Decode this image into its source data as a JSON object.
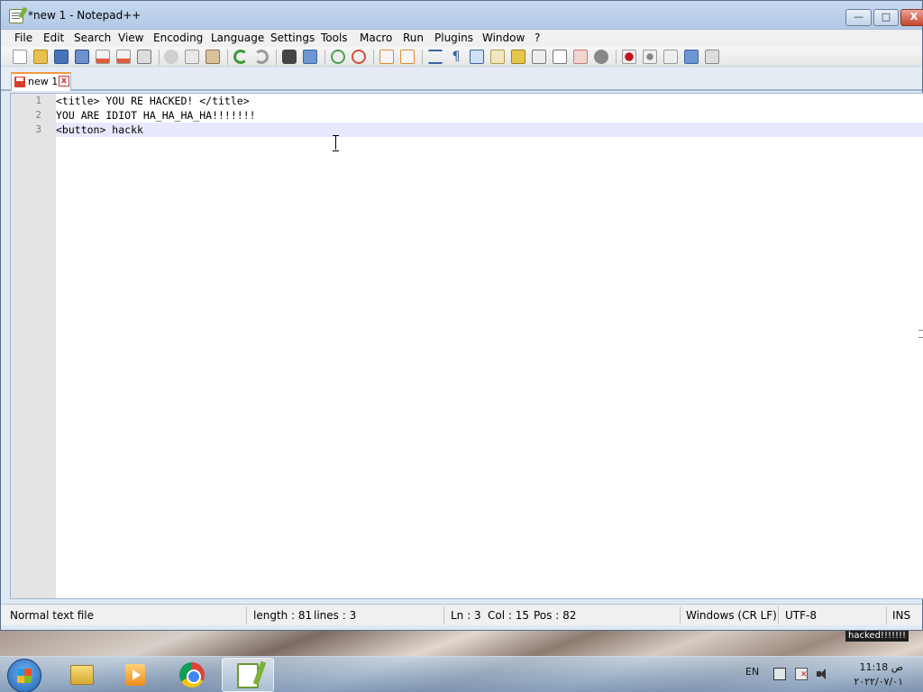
{
  "window": {
    "title": "*new 1 - Notepad++",
    "minimize": "—",
    "maximize": "□",
    "close": "X"
  },
  "menu": [
    "File",
    "Edit",
    "Search",
    "View",
    "Encoding",
    "Language",
    "Settings",
    "Tools",
    "Macro",
    "Run",
    "Plugins",
    "Window",
    "?"
  ],
  "toolbar_icons": [
    "new-file-icon",
    "open-file-icon",
    "save-icon",
    "save-all-icon",
    "close-icon",
    "close-all-icon",
    "print-icon",
    "cut-icon",
    "copy-icon",
    "paste-icon",
    "undo-icon",
    "redo-icon",
    "find-icon",
    "replace-icon",
    "zoom-in-icon",
    "zoom-out-icon",
    "sync-vertical-icon",
    "sync-horizontal-icon",
    "word-wrap-icon",
    "show-all-chars-icon",
    "indent-guide-icon",
    "doc-map-icon",
    "function-list-icon",
    "folder-as-workspace-icon",
    "monitoring-icon",
    "record-macro-icon",
    "stop-macro-icon",
    "play-macro-icon",
    "run-macro-multiple-icon",
    "save-macro-icon"
  ],
  "tab": {
    "label": "new 1",
    "close": "x"
  },
  "editor": {
    "lines": [
      {
        "num": "1",
        "text": "<title> YOU RE HACKED! </title>"
      },
      {
        "num": "2",
        "text": "YOU ARE IDIOT HA_HA_HA_HA!!!!!!!"
      },
      {
        "num": "3",
        "text": "<button> hackk"
      }
    ]
  },
  "status": {
    "file_type": "Normal text file",
    "length": "length : 81",
    "lines": "lines : 3",
    "ln": "Ln : 3",
    "col": "Col : 15",
    "pos": "Pos : 82",
    "eol": "Windows (CR LF)",
    "encoding": "UTF-8",
    "mode": "INS"
  },
  "desktop": {
    "label": "hacked!!!!!!!"
  },
  "taskbar": {
    "language": "EN",
    "time": "11:18 ص",
    "date": "٢٠٢٢/٠٧/٠١",
    "pinned": [
      "explorer-icon",
      "media-player-icon",
      "chrome-icon",
      "notepad-plus-plus-icon"
    ]
  }
}
